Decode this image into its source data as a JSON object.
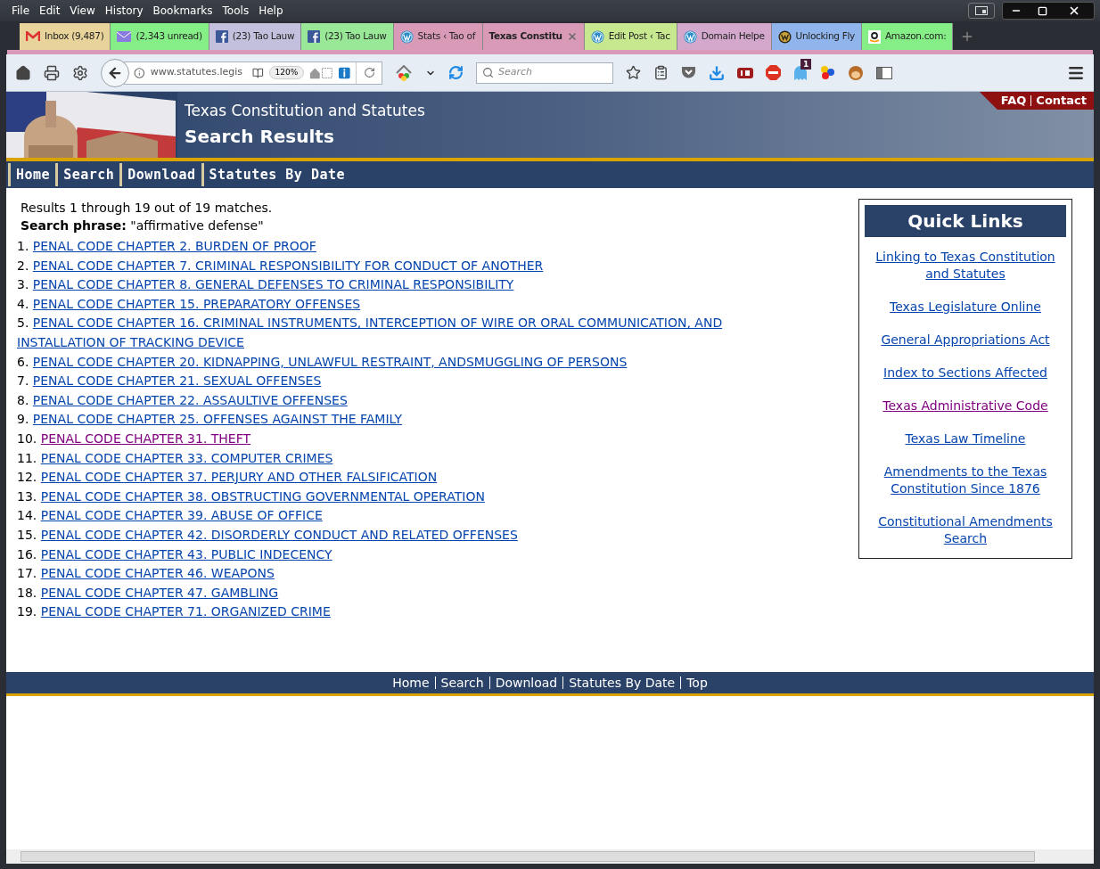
{
  "menu_bar": [
    "File",
    "Edit",
    "View",
    "History",
    "Bookmarks",
    "Tools",
    "Help"
  ],
  "tabs": [
    {
      "label": "Inbox (9,487)",
      "color": "#e8d39a",
      "selected": false
    },
    {
      "label": "(2,343 unread)",
      "color": "#86ee86",
      "selected": false
    },
    {
      "label": "(23) Tao Lauw",
      "color": "#c3c0dd",
      "selected": false
    },
    {
      "label": "(23) Tao Lauw",
      "color": "#98e898",
      "selected": false
    },
    {
      "label": "Stats ‹ Tao of",
      "color": "#d99ab8",
      "selected": false
    },
    {
      "label": "Texas Constitu",
      "color": "#d99ab8",
      "selected": true
    },
    {
      "label": "Edit Post ‹ Tac",
      "color": "#c8e890",
      "selected": false
    },
    {
      "label": "Domain Helpe",
      "color": "#d3a8cc",
      "selected": false
    },
    {
      "label": "Unlocking Fly",
      "color": "#90b4ec",
      "selected": false
    },
    {
      "label": "Amazon.com:",
      "color": "#86ee86",
      "selected": false
    }
  ],
  "toolbar": {
    "url": "www.statutes.legis",
    "zoom": "120%",
    "search_placeholder": "Search",
    "badge": "1"
  },
  "site": {
    "subtitle": "Texas Constitution and Statutes",
    "title": "Search Results",
    "top_links": [
      "FAQ",
      "Contact"
    ],
    "nav": [
      "Home",
      "Search",
      "Download",
      "Statutes By Date"
    ]
  },
  "results": {
    "summary": "Results 1 through 19 out of 19 matches.",
    "phrase_label": "Search phrase:",
    "phrase": "\"affirmative defense\"",
    "items": [
      {
        "number": "1.",
        "title": "PENAL CODE CHAPTER 2. BURDEN OF PROOF",
        "visited": false
      },
      {
        "number": "2.",
        "title": "PENAL CODE CHAPTER 7. CRIMINAL RESPONSIBILITY FOR CONDUCT OF ANOTHER",
        "visited": false
      },
      {
        "number": "3.",
        "title": "PENAL CODE CHAPTER 8. GENERAL DEFENSES TO CRIMINAL RESPONSIBILITY",
        "visited": false
      },
      {
        "number": "4.",
        "title": "PENAL CODE CHAPTER 15. PREPARATORY OFFENSES",
        "visited": false
      },
      {
        "number": "5.",
        "title": "PENAL CODE CHAPTER 16. CRIMINAL INSTRUMENTS, INTERCEPTION OF WIRE OR ORAL COMMUNICATION, AND",
        "continuation": "INSTALLATION OF TRACKING DEVICE",
        "visited": false
      },
      {
        "number": "6.",
        "title": "PENAL CODE CHAPTER 20. KIDNAPPING, UNLAWFUL RESTRAINT, ANDSMUGGLING OF PERSONS",
        "visited": false
      },
      {
        "number": "7.",
        "title": "PENAL CODE CHAPTER 21. SEXUAL OFFENSES",
        "visited": false
      },
      {
        "number": "8.",
        "title": "PENAL CODE CHAPTER 22. ASSAULTIVE OFFENSES",
        "visited": false
      },
      {
        "number": "9.",
        "title": "PENAL CODE CHAPTER 25. OFFENSES AGAINST THE FAMILY",
        "visited": false
      },
      {
        "number": "10.",
        "title": "PENAL CODE CHAPTER 31. THEFT",
        "visited": true
      },
      {
        "number": "11.",
        "title": "PENAL CODE CHAPTER 33. COMPUTER CRIMES",
        "visited": false
      },
      {
        "number": "12.",
        "title": "PENAL CODE CHAPTER 37. PERJURY AND OTHER FALSIFICATION",
        "visited": false
      },
      {
        "number": "13.",
        "title": "PENAL CODE CHAPTER 38. OBSTRUCTING GOVERNMENTAL OPERATION",
        "visited": false
      },
      {
        "number": "14.",
        "title": "PENAL CODE CHAPTER 39. ABUSE OF OFFICE",
        "visited": false
      },
      {
        "number": "15.",
        "title": "PENAL CODE CHAPTER 42. DISORDERLY CONDUCT AND RELATED OFFENSES",
        "visited": false
      },
      {
        "number": "16.",
        "title": "PENAL CODE CHAPTER 43. PUBLIC INDECENCY",
        "visited": false
      },
      {
        "number": "17.",
        "title": "PENAL CODE CHAPTER 46. WEAPONS",
        "visited": false
      },
      {
        "number": "18.",
        "title": "PENAL CODE CHAPTER 47. GAMBLING",
        "visited": false
      },
      {
        "number": "19.",
        "title": "PENAL CODE CHAPTER 71. ORGANIZED CRIME",
        "visited": false
      }
    ]
  },
  "quick_links": {
    "title": "Quick Links",
    "links": [
      {
        "label": "Linking to Texas Constitution and Statutes",
        "visited": false
      },
      {
        "label": "Texas Legislature Online",
        "visited": false
      },
      {
        "label": "General Appropriations Act",
        "visited": false
      },
      {
        "label": "Index to Sections Affected",
        "visited": false
      },
      {
        "label": "Texas Administrative Code",
        "visited": true
      },
      {
        "label": "Texas Law Timeline",
        "visited": false
      },
      {
        "label": "Amendments to the Texas Constitution Since 1876",
        "visited": false
      },
      {
        "label": "Constitutional Amendments Search",
        "visited": false
      }
    ]
  },
  "footer": [
    "Home",
    "Search",
    "Download",
    "Statutes By Date",
    "Top"
  ]
}
